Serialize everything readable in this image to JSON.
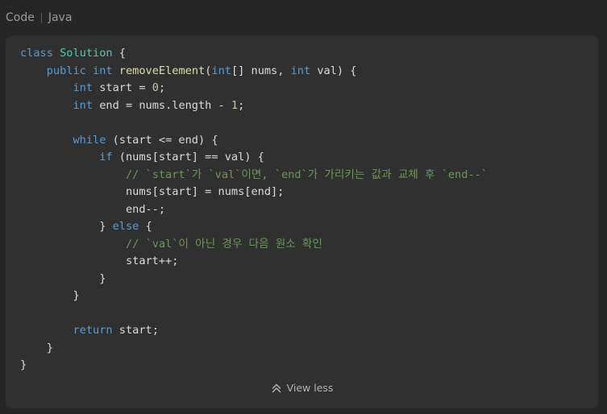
{
  "header": {
    "tab_code": "Code",
    "tab_language": "Java"
  },
  "code": {
    "language": "java",
    "lines": [
      "class Solution {",
      "    public int removeElement(int[] nums, int val) {",
      "        int start = 0;",
      "        int end = nums.length - 1;",
      "",
      "        while (start <= end) {",
      "            if (nums[start] == val) {",
      "                // `start`가 `val`이면, `end`가 가리키는 값과 교체 후 `end--`",
      "                nums[start] = nums[end];",
      "                end--;",
      "            } else {",
      "                // `val`이 아닌 경우 다음 원소 확인",
      "                start++;",
      "            }",
      "        }",
      "",
      "        return start;",
      "    }",
      "}"
    ]
  },
  "footer": {
    "toggle_label": "View less",
    "toggle_icon": "double-chevron-up-icon"
  },
  "colors": {
    "keyword": "#569cd6",
    "class_name": "#4ec9b0",
    "function": "#dcdcaa",
    "number": "#b5cea8",
    "comment": "#6a9955",
    "text": "#dcdcdc"
  }
}
